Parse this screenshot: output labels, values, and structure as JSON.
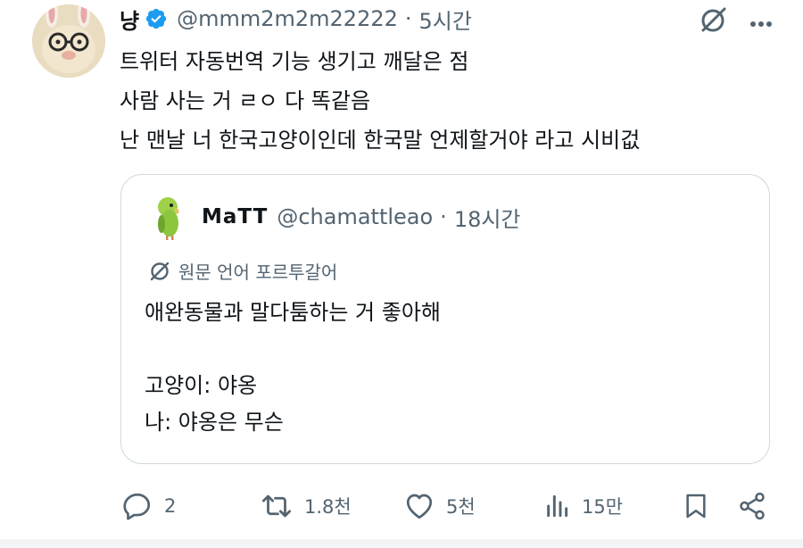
{
  "tweet": {
    "author_name": "냥",
    "handle": "@mmm2m2m22222",
    "separator": "·",
    "time": "5시간",
    "lines": [
      "트위터 자동번역 기능 생기고 깨달은 점",
      "사람 사는 거 ㄹㅇ 다 똑같음",
      "난 맨날 너 한국고양이인데 한국말 언제할거야 라고 시비겂"
    ]
  },
  "quote": {
    "author_name": "MaTT",
    "handle": "@chamattleao",
    "separator": "·",
    "time": "18시간",
    "translate_label": "원문 언어 포르투갈어",
    "lines": [
      "애완동물과 말다툼하는 거 좋아해",
      "",
      "고양이: 야옹",
      "나: 야옹은 무슨"
    ]
  },
  "actions": {
    "replies": "2",
    "retweets": "1.8천",
    "likes": "5천",
    "views": "15만"
  },
  "colors": {
    "text": "#0f1419",
    "secondary": "#536471",
    "verified": "#1d9bf0",
    "border": "#cfd9de"
  }
}
